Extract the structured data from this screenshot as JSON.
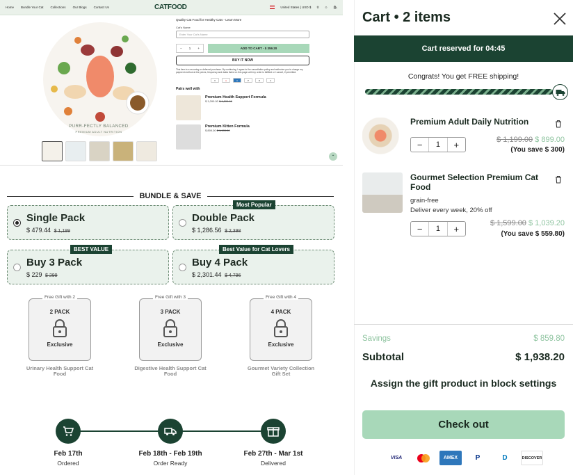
{
  "store": {
    "nav": {
      "links": [
        "Home",
        "Bundle Your Cat",
        "Collections",
        "Our Blogs",
        "Contact Us"
      ],
      "logo": "CATFOOD",
      "region": "United States | USD $"
    },
    "hero": {
      "tagline": "PURR-FECTLY BALANCED",
      "subtagline": "PREMIUM ADULT NUTRITION"
    },
    "product_info": {
      "promo": "Quality Cat Food for Healthy Cats - Learn More",
      "cat_name_label": "Cat's Name",
      "cat_name_placeholder": "Enter Your Cat's Name",
      "qty": "1",
      "add_to_cart": "ADD TO CART - $ 359.20",
      "buy_now": "BUY IT NOW",
      "legal": "This item is a recurring or deferred purchase. By continuing, I agree to the cancellation policy and authorize you to charge my payment method at the prices, frequency and dates listed on this page until my order is fulfilled or I cancel, if permitted.",
      "pairs_title": "Pairs well with",
      "pairs": [
        {
          "name": "Premium Health Support Formula",
          "price": "$ 1,099.00",
          "was": "$ 1,399.00"
        },
        {
          "name": "Premium Kitten Formula",
          "price": "$ 899.00",
          "was": "$ 1,199.00"
        }
      ]
    }
  },
  "bundle": {
    "title": "BUNDLE & SAVE",
    "packs": [
      {
        "name": "Single Pack",
        "price": "$ 479.44",
        "was": "$ 1,199",
        "ribbon": "",
        "selected": true
      },
      {
        "name": "Double Pack",
        "price": "$ 1,286.56",
        "was": "$ 2,398",
        "ribbon": "Most Popular",
        "selected": false
      },
      {
        "name": "Buy 3 Pack",
        "price": "$ 229",
        "was": "$ 299",
        "ribbon": "BEST VALUE",
        "selected": false
      },
      {
        "name": "Buy 4 Pack",
        "price": "$ 2,301.44",
        "was": "$ 4,796",
        "ribbon": "Best Value for Cat Lovers",
        "selected": false
      }
    ],
    "gifts": [
      {
        "tag": "Free Gift with 2",
        "pack": "2 PACK",
        "status": "Exclusive",
        "label": "Urinary Health Support Cat Food"
      },
      {
        "tag": "Free Gift with 3",
        "pack": "3 PACK",
        "status": "Exclusive",
        "label": "Digestive Health Support Cat Food"
      },
      {
        "tag": "Free Gift with 4",
        "pack": "4 PACK",
        "status": "Exclusive",
        "label": "Gourmet Variety Collection Gift Set"
      }
    ],
    "timeline": [
      {
        "date": "Feb 17th",
        "status": "Ordered",
        "icon": "cart-icon"
      },
      {
        "date": "Feb 18th - Feb 19th",
        "status": "Order Ready",
        "icon": "truck-icon"
      },
      {
        "date": "Feb 27th - Mar 1st",
        "status": "Delivered",
        "icon": "gift-icon"
      }
    ]
  },
  "cart": {
    "title": "Cart • 2 items",
    "reserved": "Cart reserved for 04:45",
    "congrats": "Congrats! You get FREE shipping!",
    "shipping_progress": 1.0,
    "items": [
      {
        "name": "Premium Adult Daily Nutrition",
        "meta1": "",
        "meta2": "",
        "qty": "1",
        "was": "$ 1,199.00",
        "now": "$ 899.00",
        "save": "(You save $ 300)"
      },
      {
        "name": "Gourmet Selection Premium Cat Food",
        "meta1": "grain-free",
        "meta2": "Deliver every week, 20% off",
        "qty": "1",
        "was": "$ 1,599.00",
        "now": "$ 1,039.20",
        "save": "(You save $ 559.80)"
      }
    ],
    "savings_label": "Savings",
    "savings_value": "$ 859.80",
    "subtotal_label": "Subtotal",
    "subtotal_value": "$ 1,938.20",
    "assign": "Assign the gift product in block settings",
    "checkout": "Check out",
    "payment_cards": [
      "VISA",
      "mastercard",
      "AMEX",
      "PayPal",
      "Diners",
      "DISCOVER"
    ]
  },
  "colors": {
    "brand_dark": "#1b4332",
    "brand_light": "#a8d8b9",
    "price_green": "#8fc4a0"
  }
}
